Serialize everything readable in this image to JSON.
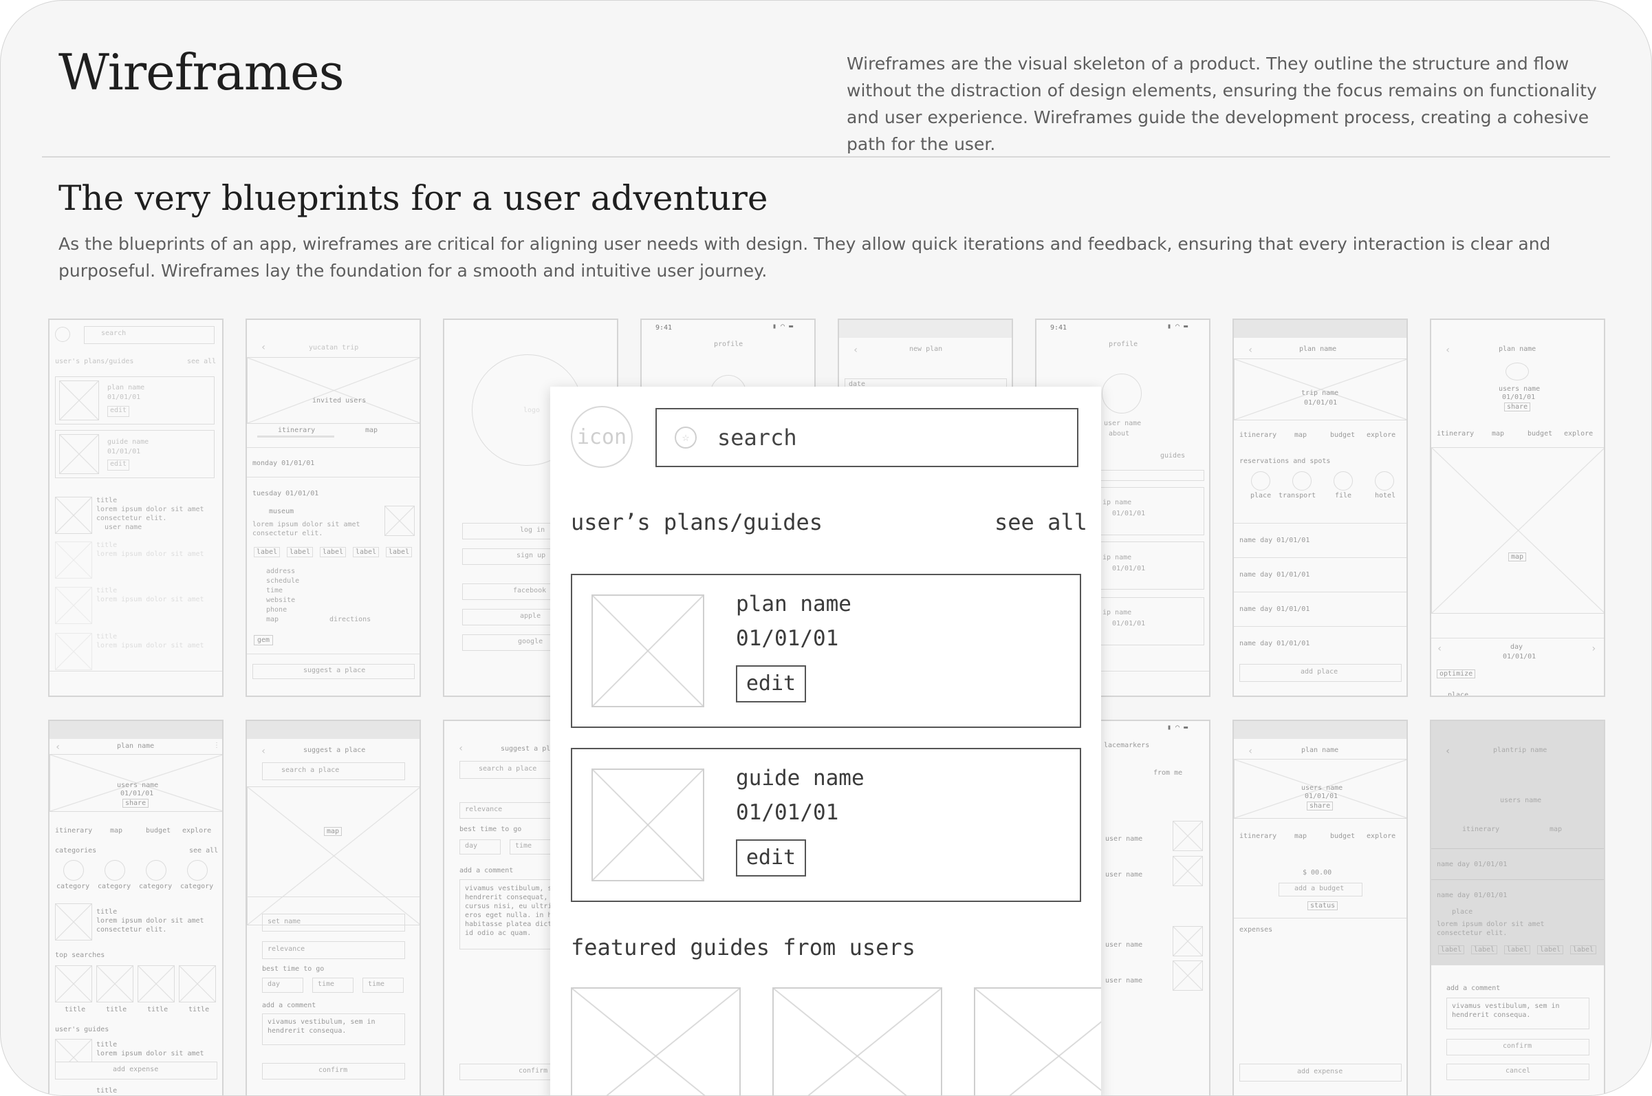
{
  "header": {
    "title": "Wireframes",
    "intro": "Wireframes are the visual skeleton of a product. They outline the structure and flow without the distraction of design elements, ensuring the focus remains on functionality and user experience. Wireframes guide the development process, creating a cohesive path for the user."
  },
  "section": {
    "title": "The very blueprints for a user adventure",
    "description": "As the blueprints of an app, wireframes are critical for aligning user needs with design. They allow quick iterations and feedback, ensuring that every interaction is clear and purposeful. Wireframes lay the foundation for a smooth and intuitive user journey."
  },
  "featured": {
    "avatar_label": "icon",
    "search_text": "search",
    "section_heading": "user’s plans/guides",
    "see_all": "see all",
    "cards": [
      {
        "name": "plan name",
        "date": "01/01/01",
        "edit": "edit"
      },
      {
        "name": "guide name",
        "date": "01/01/01",
        "edit": "edit"
      }
    ],
    "featured_heading": "featured guides from users"
  },
  "thumbs": {
    "t1": {
      "search": "search",
      "section": "user's plans/guides",
      "seeall": "see all",
      "plan": "plan name",
      "guide": "guide name",
      "date": "01/01/01",
      "edit": "edit",
      "title": "title",
      "lorem": "lorem ipsum dolor sit amet",
      "lorem2": "consectetur elit.",
      "user": "user name"
    },
    "t2": {
      "title": "yucatan trip",
      "invited": "invited users",
      "tab1": "itinerary",
      "tab2": "map",
      "day1": "monday  01/01/01",
      "day2": "tuesday  01/01/01",
      "museum": "museum",
      "lorem": "lorem ipsum dolor sit amet",
      "lorem2": "consectetur elit.",
      "label": "label",
      "address": "address",
      "schedule": "schedule",
      "time": "time",
      "website": "website",
      "phone": "phone",
      "map": "map",
      "directions": "directions",
      "gem": "gem",
      "suggest": "suggest a place"
    },
    "t3": {
      "logo": "logo",
      "login": "log in",
      "signup": "sign up",
      "facebook": "facebook",
      "apple": "apple",
      "google": "google"
    },
    "t4": {
      "time": "9:41",
      "title": "profile"
    },
    "t5": {
      "title": "new plan",
      "field": "date"
    },
    "t6": {
      "time": "9:41",
      "title": "profile",
      "user": "user name",
      "about": "about",
      "guides": "guides",
      "trip": "ip name",
      "date": "01/01/01"
    },
    "t7": {
      "title": "plan name",
      "trip": "trip name",
      "date": "01/01/01",
      "tab1": "itinerary",
      "tab2": "map",
      "tab3": "budget",
      "tab4": "explore",
      "reservations": "reservations and spots",
      "c1": "place",
      "c2": "transport",
      "c3": "file",
      "c4": "hotel",
      "day": "name day  01/01/01",
      "add": "add place"
    },
    "t8": {
      "title": "plan name",
      "users": "users name",
      "date": "01/01/01",
      "share": "share",
      "tab1": "itinerary",
      "tab2": "map",
      "tab3": "budget",
      "tab4": "explore",
      "map": "map",
      "day": "day",
      "date2": "01/01/01",
      "optimize": "optimize",
      "place": "place"
    },
    "t9": {
      "title": "plan name",
      "users": "users name",
      "date": "01/01/01",
      "share": "share",
      "tab1": "itinerary",
      "tab2": "map",
      "tab3": "budget",
      "tab4": "explore",
      "categories": "categories",
      "seeall": "see all",
      "category": "category",
      "ttl": "title",
      "lorem": "lorem ipsum dolor sit amet",
      "lorem2": "consectetur elit.",
      "top": "top searches",
      "guides": "user's guides",
      "add": "add expense"
    },
    "t10": {
      "title": "suggest a place",
      "search": "search a place",
      "map": "map",
      "setname": "set name",
      "relevance": "relevance",
      "best": "best time to go",
      "day": "day",
      "time": "time",
      "comment": "add a comment",
      "text": "vivamus vestibulum, sem in",
      "text2": "hendrerit consequa.",
      "confirm": "confirm"
    },
    "t11": {
      "title": "suggest a pla",
      "search": "search a place",
      "relevance": "relevance",
      "best": "best time to go",
      "day": "day",
      "time": "time",
      "comment": "add a comment",
      "text": "vivamus vestibulum, se",
      "text2": "hendrerit consequat,",
      "text3": "cursus nisi, eu ultric",
      "text4": "eros eget nulla. in h",
      "text5": "habitasse platea dict",
      "text6": "id odio ac quam.",
      "confirm": "confirm"
    },
    "t12": {
      "title": "lacemarkers",
      "from": "from me",
      "user": "user name"
    },
    "t13": {
      "title": "plan name",
      "users": "users name",
      "date": "01/01/01",
      "share": "share",
      "tab1": "itinerary",
      "tab2": "map",
      "tab3": "budget",
      "tab4": "explore",
      "amount": "$ 00.00",
      "budget": "add a budget",
      "status": "status",
      "expenses": "expenses",
      "add": "add expense"
    },
    "t14": {
      "title": "plantrip name",
      "users": "users name",
      "tab1": "itinerary",
      "tab2": "map",
      "day": "name day  01/01/01",
      "place": "place",
      "lorem": "lorem ipsum dolor sit amet",
      "lorem2": "consectetur elit.",
      "label": "label",
      "comment": "add a comment",
      "text": "vivamus vestibulum, sem in",
      "text2": "hendrerit consequa.",
      "confirm": "confirm",
      "cancel": "cancel"
    }
  }
}
